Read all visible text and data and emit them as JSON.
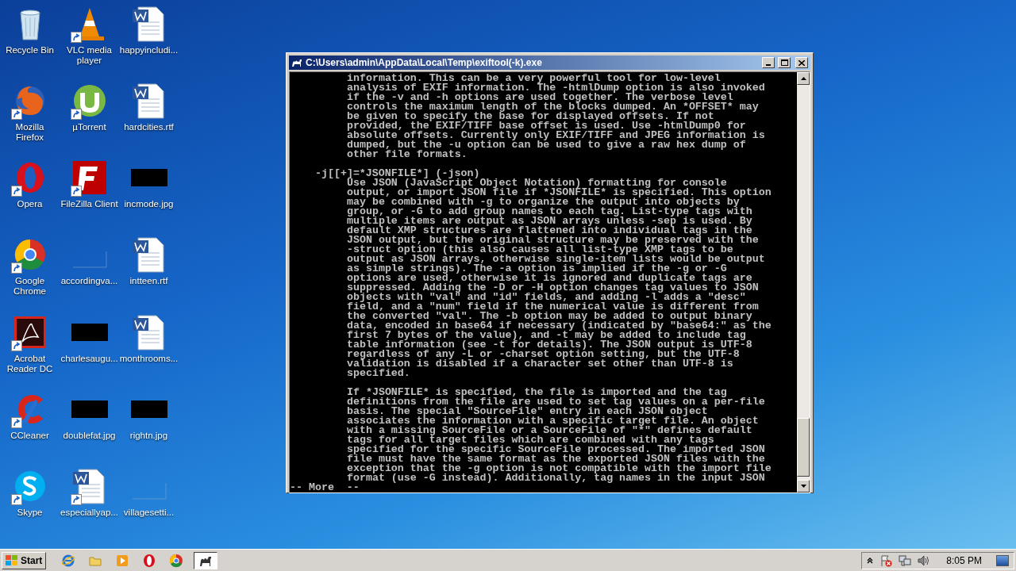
{
  "desktop_icons": [
    {
      "label": "Recycle Bin",
      "kind": "recycle",
      "shortcut": false
    },
    {
      "label": "Mozilla Firefox",
      "kind": "firefox",
      "shortcut": true
    },
    {
      "label": "Opera",
      "kind": "opera",
      "shortcut": true
    },
    {
      "label": "Google Chrome",
      "kind": "chrome",
      "shortcut": true
    },
    {
      "label": "Acrobat Reader DC",
      "kind": "acrobat",
      "shortcut": true
    },
    {
      "label": "CCleaner",
      "kind": "ccleaner",
      "shortcut": true
    },
    {
      "label": "Skype",
      "kind": "skype",
      "shortcut": true
    },
    {
      "label": "VLC media player",
      "kind": "vlc",
      "shortcut": true
    },
    {
      "label": "µTorrent",
      "kind": "utorrent",
      "shortcut": true
    },
    {
      "label": "FileZilla Client",
      "kind": "filezilla",
      "shortcut": true
    },
    {
      "label": "accordingva...",
      "kind": "blank",
      "shortcut": false
    },
    {
      "label": "charlesaugu...",
      "kind": "image",
      "shortcut": false
    },
    {
      "label": "doublefat.jpg",
      "kind": "image",
      "shortcut": false
    },
    {
      "label": "especiallyap...",
      "kind": "word",
      "shortcut": true
    },
    {
      "label": "happyincludi...",
      "kind": "word",
      "shortcut": false
    },
    {
      "label": "hardcities.rtf",
      "kind": "word",
      "shortcut": false
    },
    {
      "label": "incmode.jpg",
      "kind": "image",
      "shortcut": false
    },
    {
      "label": "intteen.rtf",
      "kind": "word",
      "shortcut": false
    },
    {
      "label": "monthrooms...",
      "kind": "word",
      "shortcut": false
    },
    {
      "label": "rightn.jpg",
      "kind": "image",
      "shortcut": false
    },
    {
      "label": "villagesetti...",
      "kind": "blank",
      "shortcut": false
    }
  ],
  "window": {
    "title": "C:\\Users\\admin\\AppData\\Local\\Temp\\exiftool(-k).exe",
    "console_lines": [
      {
        "kind": "body",
        "text": "information. This can be a very powerful tool for low-level"
      },
      {
        "kind": "body",
        "text": "analysis of EXIF information. The -htmlDump option is also invoked"
      },
      {
        "kind": "body",
        "text": "if the -v and -h options are used together. The verbose level"
      },
      {
        "kind": "body",
        "text": "controls the maximum length of the blocks dumped. An *OFFSET* may"
      },
      {
        "kind": "body",
        "text": "be given to specify the base for displayed offsets. If not"
      },
      {
        "kind": "body",
        "text": "provided, the EXIF/TIFF base offset is used. Use -htmlDump0 for"
      },
      {
        "kind": "body",
        "text": "absolute offsets. Currently only EXIF/TIFF and JPEG information is"
      },
      {
        "kind": "body",
        "text": "dumped, but the -u option can be used to give a raw hex dump of"
      },
      {
        "kind": "body",
        "text": "other file formats."
      },
      {
        "kind": "blank"
      },
      {
        "kind": "option",
        "text": "-j[[+]=*JSONFILE*] (-json)"
      },
      {
        "kind": "body",
        "text": "Use JSON (JavaScript Object Notation) formatting for console"
      },
      {
        "kind": "body",
        "text": "output, or import JSON file if *JSONFILE* is specified. This option"
      },
      {
        "kind": "body",
        "text": "may be combined with -g to organize the output into objects by"
      },
      {
        "kind": "body",
        "text": "group, or -G to add group names to each tag. List-type tags with"
      },
      {
        "kind": "body",
        "text": "multiple items are output as JSON arrays unless -sep is used. By"
      },
      {
        "kind": "body",
        "text": "default XMP structures are flattened into individual tags in the"
      },
      {
        "kind": "body",
        "text": "JSON output, but the original structure may be preserved with the"
      },
      {
        "kind": "body",
        "text": "-struct option (this also causes all list-type XMP tags to be"
      },
      {
        "kind": "body",
        "text": "output as JSON arrays, otherwise single-item lists would be output"
      },
      {
        "kind": "body",
        "text": "as simple strings). The -a option is implied if the -g or -G"
      },
      {
        "kind": "body",
        "text": "options are used, otherwise it is ignored and duplicate tags are"
      },
      {
        "kind": "body",
        "text": "suppressed. Adding the -D or -H option changes tag values to JSON"
      },
      {
        "kind": "body",
        "text": "objects with \"val\" and \"id\" fields, and adding -l adds a \"desc\""
      },
      {
        "kind": "body",
        "text": "field, and a \"num\" field if the numerical value is different from"
      },
      {
        "kind": "body",
        "text": "the converted \"val\". The -b option may be added to output binary"
      },
      {
        "kind": "body",
        "text": "data, encoded in base64 if necessary (indicated by \"base64:\" as the"
      },
      {
        "kind": "body",
        "text": "first 7 bytes of the value), and -t may be added to include tag"
      },
      {
        "kind": "body",
        "text": "table information (see -t for details). The JSON output is UTF-8"
      },
      {
        "kind": "body",
        "text": "regardless of any -L or -charset option setting, but the UTF-8"
      },
      {
        "kind": "body",
        "text": "validation is disabled if a character set other than UTF-8 is"
      },
      {
        "kind": "body",
        "text": "specified."
      },
      {
        "kind": "blank"
      },
      {
        "kind": "body",
        "text": "If *JSONFILE* is specified, the file is imported and the tag"
      },
      {
        "kind": "body",
        "text": "definitions from the file are used to set tag values on a per-file"
      },
      {
        "kind": "body",
        "text": "basis. The special \"SourceFile\" entry in each JSON object"
      },
      {
        "kind": "body",
        "text": "associates the information with a specific target file. An object"
      },
      {
        "kind": "body",
        "text": "with a missing SourceFile or a SourceFile of \"*\" defines default"
      },
      {
        "kind": "body",
        "text": "tags for all target files which are combined with any tags"
      },
      {
        "kind": "body",
        "text": "specified for the specific SourceFile processed. The imported JSON"
      },
      {
        "kind": "body",
        "text": "file must have the same format as the exported JSON files with the"
      },
      {
        "kind": "body",
        "text": "exception that the -g option is not compatible with the import file"
      },
      {
        "kind": "body",
        "text": "format (use -G instead). Additionally, tag names in the input JSON"
      },
      {
        "kind": "prompt",
        "text": "-- More  --"
      }
    ]
  },
  "taskbar": {
    "start_label": "Start",
    "apps": [
      {
        "kind": "ie",
        "selected": false
      },
      {
        "kind": "folder",
        "selected": false
      },
      {
        "kind": "media",
        "selected": false
      },
      {
        "kind": "opera",
        "selected": false
      },
      {
        "kind": "chrome",
        "selected": false
      },
      {
        "kind": "camel",
        "selected": true
      }
    ],
    "clock": "8:05 PM"
  }
}
